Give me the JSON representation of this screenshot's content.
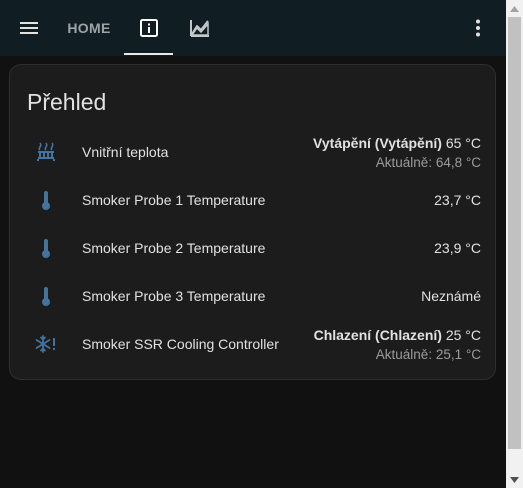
{
  "toolbar": {
    "home_tab_label": "HOME",
    "accent_color": "#101e24"
  },
  "card": {
    "title": "Přehled",
    "icon_color": "#44739e",
    "rows": [
      {
        "icon": "radiator-icon",
        "name": "Vnitřní teplota",
        "mode": "Vytápění (Vytápění)",
        "value": "65 °C",
        "current": "Aktuálně: 64,8 °C"
      },
      {
        "icon": "thermometer-icon",
        "name": "Smoker Probe 1 Temperature",
        "value": "23,7 °C"
      },
      {
        "icon": "thermometer-icon",
        "name": "Smoker Probe 2 Temperature",
        "value": "23,9 °C"
      },
      {
        "icon": "thermometer-icon",
        "name": "Smoker Probe 3 Temperature",
        "value": "Neznámé"
      },
      {
        "icon": "snowflake-alert-icon",
        "name": "Smoker SSR Cooling Controller",
        "mode": "Chlazení (Chlazení)",
        "value": "25 °C",
        "current": "Aktuálně: 25,1 °C"
      }
    ]
  }
}
